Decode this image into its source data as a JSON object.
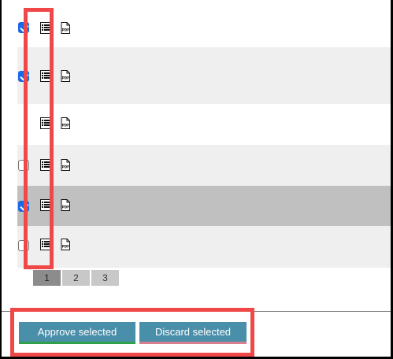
{
  "rows": [
    {
      "checkbox": "checked",
      "shade": "none"
    },
    {
      "checkbox": "checked",
      "shade": "light"
    },
    {
      "checkbox": "none",
      "shade": "none"
    },
    {
      "checkbox": "unchecked",
      "shade": "light"
    },
    {
      "checkbox": "checked",
      "shade": "selected"
    },
    {
      "checkbox": "unchecked",
      "shade": "light"
    }
  ],
  "icons": {
    "list": "list-details-icon",
    "pdf": "pdf-icon",
    "pdf_text": "PDF"
  },
  "pagination": {
    "pages": [
      "1",
      "2",
      "3"
    ],
    "current": "1"
  },
  "actions": {
    "approve_label": "Approve selected",
    "discard_label": "Discard selected"
  },
  "colors": {
    "checkbox_checked": "#1a6ae8",
    "button_bg": "#4a8faa",
    "approve_underline": "#2fa14a",
    "discard_underline": "#d97f92",
    "highlight": "#f04848",
    "row_shade": "#efefef",
    "row_selected": "#c0c0c0"
  }
}
